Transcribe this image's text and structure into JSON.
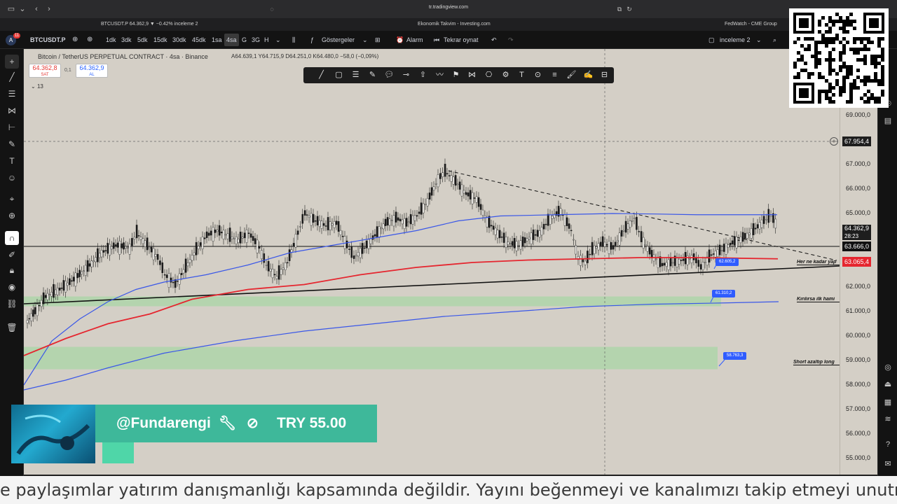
{
  "browser": {
    "url": "tr.tradingview.com",
    "tabs": [
      {
        "label": "BTCUSDT.P 64.362,9 ▼ −0.42% inceleme 2"
      },
      {
        "label": "Ekonomik Takvim - Investing.com"
      },
      {
        "label": "FedWatch - CME Group"
      }
    ]
  },
  "toolbar": {
    "symbol": "BTCUSDT.P",
    "notification_count": "11",
    "timeframes": [
      "1dk",
      "3dk",
      "5dk",
      "15dk",
      "30dk",
      "45dk",
      "1sa",
      "4sa",
      "G",
      "3G",
      "H"
    ],
    "active_timeframe": "4sa",
    "indicators_label": "Göstergeler",
    "alert_label": "Alarm",
    "replay_label": "Tekrar oynat",
    "layout_name": "inceleme 2"
  },
  "legend": {
    "title": "Bitcoin / TetherUS PERPETUAL CONTRACT · 4sa · Binance",
    "ohlc": "A64.639,1  Y64.715,9  D64.251,0  K64.480,0  −58,0 (−0,09%)",
    "sell_price": "64.362,8",
    "sell_label": "SAT",
    "spread": "0,1",
    "buy_price": "64.362,9",
    "buy_label": "AL",
    "indicator_count": "13"
  },
  "price_axis": {
    "ticks": [
      "69.000,0",
      "67.000,0",
      "66.000,0",
      "65.000,0",
      "62.000,0",
      "61.000,0",
      "60.000,0",
      "59.000,0",
      "58.000,0",
      "57.000,0",
      "56.000,0",
      "55.000,0"
    ],
    "crosshair_price": "67.954,4",
    "last_price": "64.362,9",
    "countdown": "28:23",
    "level_black": "63.666,0",
    "level_red": "63.065,4"
  },
  "annotations": {
    "tag_1": "62.605,2",
    "tag_2": "61.310,2",
    "tag_3": "58.763,3",
    "note_1": "Her ne kadar yap",
    "note_2": "Kırılırsa ilk hami",
    "note_3": "Short azaltıp long"
  },
  "donation": {
    "user": "@Fundarengi",
    "amount": "TRY 55.00"
  },
  "ticker": {
    "text": "e paylaşımlar yatırım danışmanlığı kapsamında değildir. Yayını beğenmeyi ve kanalımızı takip etmeyi unutm"
  },
  "colors": {
    "chart_bg": "#d4cfc6",
    "ma_blue": "#3a57e8",
    "ma_red": "#e5262f",
    "support_zone": "#a9d6a6",
    "donation_bg": "#3eb89a"
  }
}
